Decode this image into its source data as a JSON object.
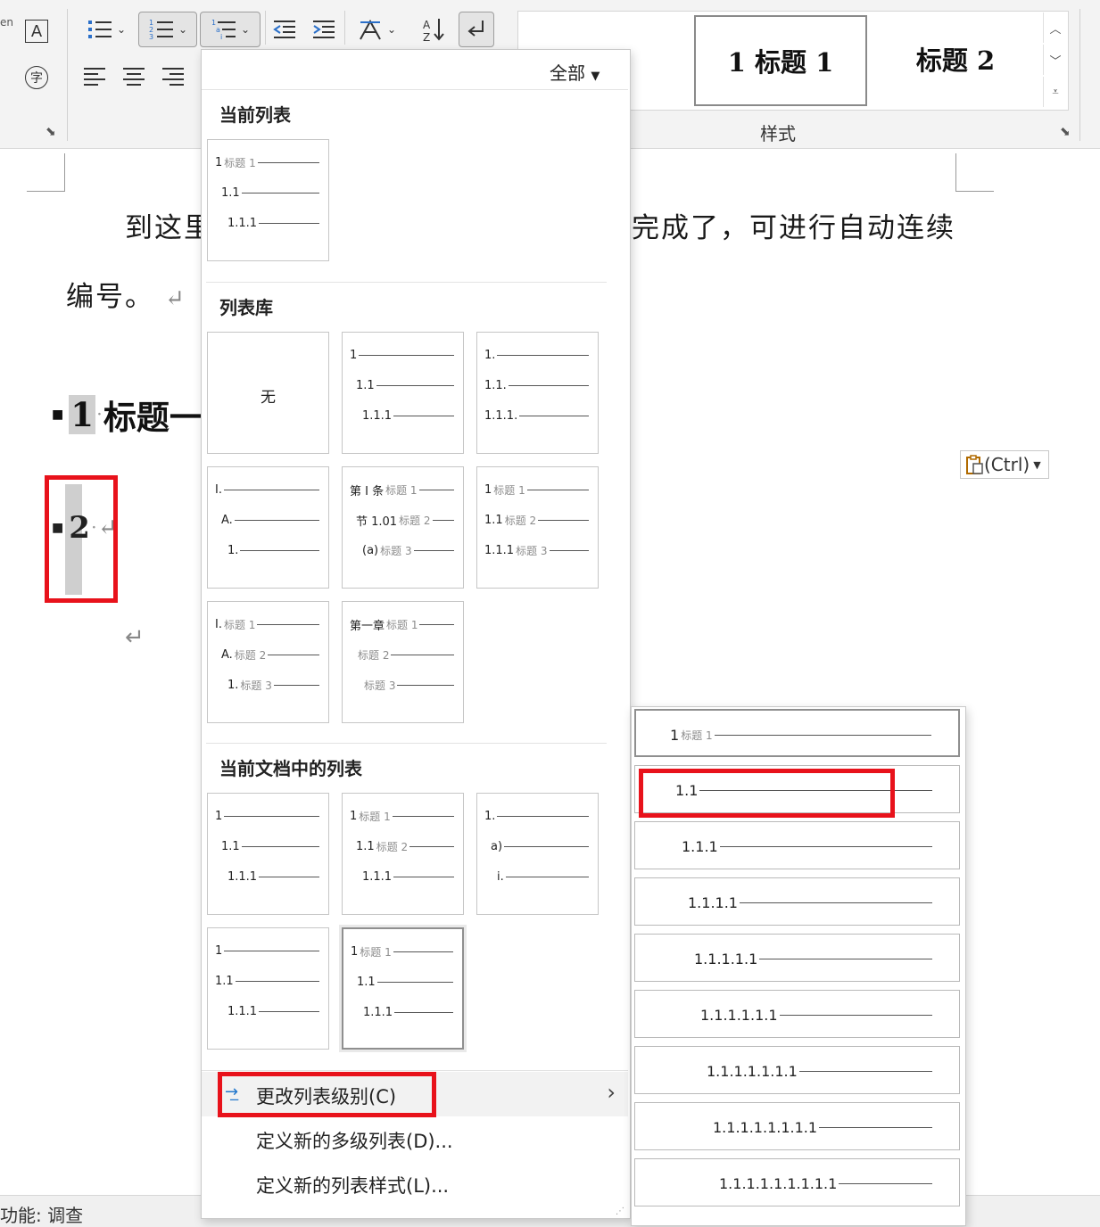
{
  "ribbon": {
    "left_partial_text": "en",
    "launcher_glyph": "⬊",
    "styles": {
      "tile1": "1  标题 1",
      "tile2": "标题 2",
      "group_label": "样式"
    }
  },
  "document": {
    "line1_left": "到这里",
    "line1_right": "完成了，可进行自动连续",
    "line2": "编号。",
    "return_mark": "↵",
    "heading1_num": "1",
    "heading1_text": "标题一",
    "para2_num": "2"
  },
  "paste_options": {
    "label": "(Ctrl)"
  },
  "statusbar": {
    "text": "功能: 调查"
  },
  "dropdown": {
    "filter_label": "全部",
    "sections": {
      "current": "当前列表",
      "library": "列表库",
      "in_document": "当前文档中的列表"
    },
    "none_label": "无",
    "tiles": {
      "current": [
        [
          {
            "n": "1",
            "t": "标题 1"
          },
          {
            "n": "1.1",
            "t": ""
          },
          {
            "n": "1.1.1",
            "t": ""
          }
        ]
      ],
      "library": [
        [
          {
            "n": "1",
            "t": ""
          },
          {
            "n": "1.1",
            "t": ""
          },
          {
            "n": "1.1.1",
            "t": ""
          }
        ],
        [
          {
            "n": "1.",
            "t": ""
          },
          {
            "n": "1.1.",
            "t": ""
          },
          {
            "n": "1.1.1.",
            "t": ""
          }
        ],
        [
          {
            "n": "I.",
            "t": ""
          },
          {
            "n": "A.",
            "t": ""
          },
          {
            "n": "1.",
            "t": ""
          }
        ],
        [
          {
            "n": "第 I 条",
            "t": "标题 1"
          },
          {
            "n": "节 1.01",
            "t": "标题 2"
          },
          {
            "n": "(a)",
            "t": "标题 3"
          }
        ],
        [
          {
            "n": "1",
            "t": "标题 1"
          },
          {
            "n": "1.1",
            "t": "标题 2"
          },
          {
            "n": "1.1.1",
            "t": "标题 3"
          }
        ],
        [
          {
            "n": "I.",
            "t": "标题 1"
          },
          {
            "n": "A.",
            "t": "标题 2"
          },
          {
            "n": "1.",
            "t": "标题 3"
          }
        ],
        [
          {
            "n": "第一章",
            "t": "标题 1"
          },
          {
            "n": "",
            "t": "标题 2"
          },
          {
            "n": "",
            "t": "标题 3"
          }
        ]
      ],
      "in_document": [
        [
          {
            "n": "1",
            "t": ""
          },
          {
            "n": "1.1",
            "t": ""
          },
          {
            "n": "1.1.1",
            "t": ""
          }
        ],
        [
          {
            "n": "1",
            "t": "标题 1"
          },
          {
            "n": "1.1",
            "t": "标题 2"
          },
          {
            "n": "1.1.1",
            "t": ""
          }
        ],
        [
          {
            "n": "1.",
            "t": ""
          },
          {
            "n": "a)",
            "t": ""
          },
          {
            "n": "i.",
            "t": ""
          }
        ],
        [
          {
            "n": "1",
            "t": ""
          },
          {
            "n": "1.1",
            "t": ""
          },
          {
            "n": "1.1.1",
            "t": ""
          }
        ],
        [
          {
            "n": "1",
            "t": "标题 1"
          },
          {
            "n": "1.1",
            "t": ""
          },
          {
            "n": "1.1.1",
            "t": ""
          }
        ]
      ]
    },
    "menu": {
      "change_level": "更改列表级别(C)",
      "define_multilevel": "定义新的多级列表(D)...",
      "define_style": "定义新的列表样式(L)..."
    }
  },
  "submenu": {
    "levels": [
      {
        "n": "1",
        "t": "标题 1"
      },
      {
        "n": "1.1",
        "t": ""
      },
      {
        "n": "1.1.1",
        "t": ""
      },
      {
        "n": "1.1.1.1",
        "t": ""
      },
      {
        "n": "1.1.1.1.1",
        "t": ""
      },
      {
        "n": "1.1.1.1.1.1",
        "t": ""
      },
      {
        "n": "1.1.1.1.1.1.1",
        "t": ""
      },
      {
        "n": "1.1.1.1.1.1.1.1",
        "t": ""
      },
      {
        "n": "1.1.1.1.1.1.1.1.1",
        "t": ""
      }
    ]
  },
  "highlight_color": "#e8121b"
}
